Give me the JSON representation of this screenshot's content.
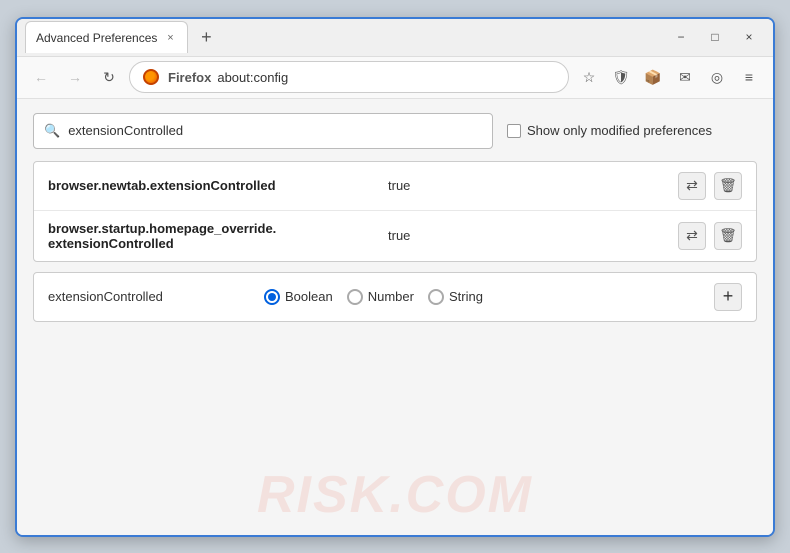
{
  "window": {
    "title": "Advanced Preferences",
    "tab_close": "×",
    "new_tab": "+",
    "controls": {
      "minimize": "−",
      "maximize": "□",
      "close": "×"
    }
  },
  "toolbar": {
    "back_label": "←",
    "forward_label": "→",
    "refresh_label": "↻",
    "browser_name": "Firefox",
    "url": "about:config",
    "icons": [
      "☆",
      "🛡",
      "📦",
      "✉",
      "◎",
      "≡"
    ]
  },
  "content": {
    "watermark": "RISK.COM",
    "search": {
      "placeholder": "extensionControlled",
      "value": "extensionControlled"
    },
    "show_modified_label": "Show only modified preferences",
    "preferences": [
      {
        "name": "browser.newtab.extensionControlled",
        "value": "true"
      },
      {
        "name": "browser.startup.homepage_override.\nextensionControlled",
        "name_line1": "browser.startup.homepage_override.",
        "name_line2": "extensionControlled",
        "value": "true"
      }
    ],
    "new_pref": {
      "name": "extensionControlled",
      "types": [
        {
          "label": "Boolean",
          "selected": true
        },
        {
          "label": "Number",
          "selected": false
        },
        {
          "label": "String",
          "selected": false
        }
      ],
      "add_label": "+"
    }
  }
}
